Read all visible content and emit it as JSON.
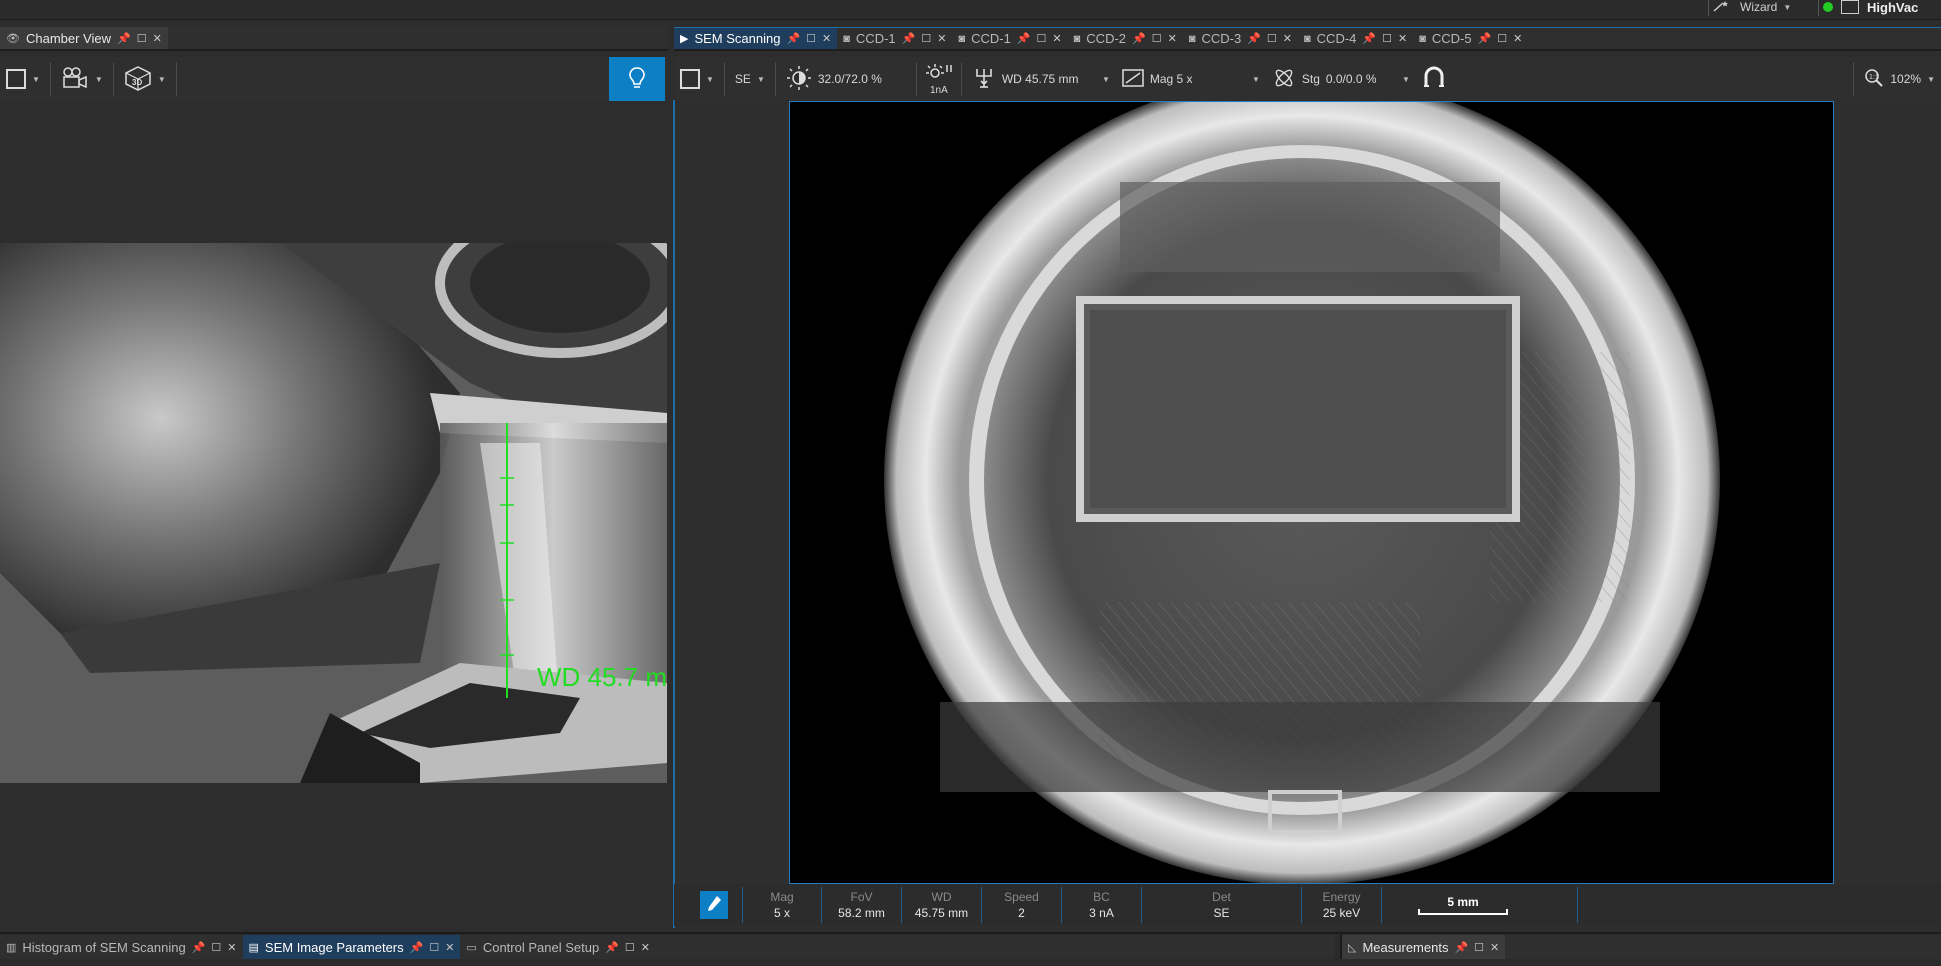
{
  "top": {
    "wizard_label": "Wizard",
    "vacuum_label": "HighVac"
  },
  "chamber_panel": {
    "tab_label": "Chamber View",
    "overlay_text": "WD 45.7 m"
  },
  "sem_tabs": [
    {
      "label": "SEM Scanning"
    },
    {
      "label": "CCD-1"
    },
    {
      "label": "CCD-1"
    },
    {
      "label": "CCD-2"
    },
    {
      "label": "CCD-3"
    },
    {
      "label": "CCD-4"
    },
    {
      "label": "CCD-5"
    }
  ],
  "sem_toolbar": {
    "detector": "SE",
    "contrast": "32.0/72.0 %",
    "current_unit": "1nA",
    "wd": "WD 45.75 mm",
    "mag": "Mag 5 x",
    "stig": "Stg",
    "stig_value": "0.0/0.0 %",
    "zoom": "102%"
  },
  "info_bar": {
    "cells": [
      {
        "label": "Mag",
        "value": "5 x"
      },
      {
        "label": "FoV",
        "value": "58.2 mm"
      },
      {
        "label": "WD",
        "value": "45.75 mm"
      },
      {
        "label": "Speed",
        "value": "2"
      },
      {
        "label": "BC",
        "value": "3 nA"
      },
      {
        "label": "Det",
        "value": "SE"
      },
      {
        "label": "Energy",
        "value": "25 keV"
      }
    ],
    "scale_label": "5 mm"
  },
  "bottom_tabs": [
    {
      "label": "Histogram of SEM Scanning"
    },
    {
      "label": "SEM Image Parameters"
    },
    {
      "label": "Control Panel Setup"
    }
  ],
  "measurements_tab": {
    "label": "Measurements"
  },
  "colors": {
    "accent": "#0d7fc4",
    "overlay_green": "#22dd22"
  }
}
